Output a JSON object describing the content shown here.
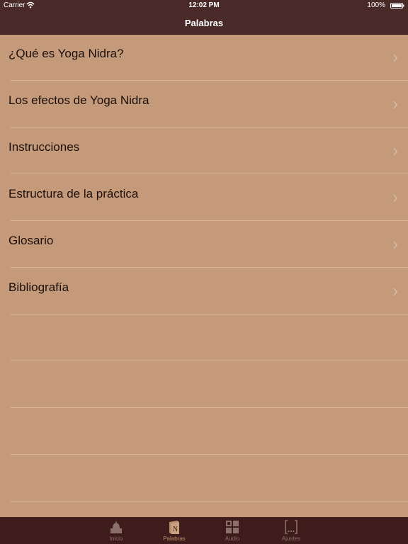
{
  "status_bar": {
    "carrier": "Carrier",
    "time": "12:02 PM",
    "battery": "100%"
  },
  "nav": {
    "title": "Palabras"
  },
  "list": {
    "items": [
      {
        "label": "¿Qué es Yoga Nidra?"
      },
      {
        "label": "Los efectos de Yoga Nidra"
      },
      {
        "label": "Instrucciones"
      },
      {
        "label": "Estructura de la práctica"
      },
      {
        "label": "Glosario"
      },
      {
        "label": "Bibliografía"
      }
    ]
  },
  "tab_bar": {
    "tabs": [
      {
        "label": "Inicio",
        "icon": "temple-icon",
        "active": false
      },
      {
        "label": "Palabras",
        "icon": "book-icon",
        "active": true
      },
      {
        "label": "Audio",
        "icon": "grid-icon",
        "active": false
      },
      {
        "label": "Ajustes",
        "icon": "brackets-icon",
        "active": false
      }
    ]
  },
  "colors": {
    "bar": "#4a2a28",
    "tab_bar": "#3e1c1c",
    "background": "#c49a7b",
    "active_tab": "#b88f6b"
  }
}
